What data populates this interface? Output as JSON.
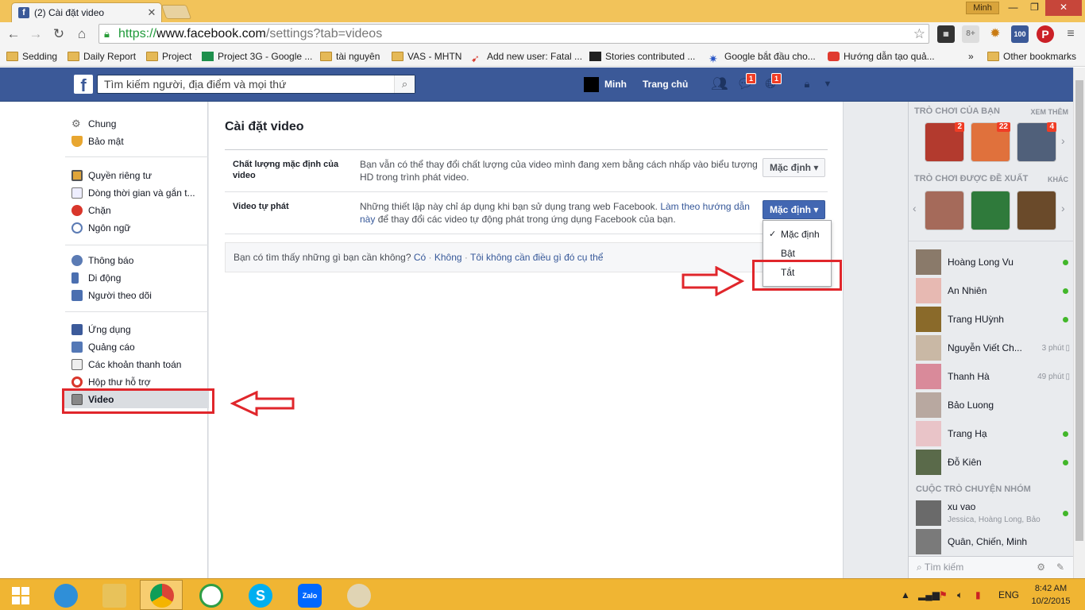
{
  "browser": {
    "tab_title": "(2) Cài đặt video",
    "user_badge": "Minh",
    "url_scheme": "https://",
    "url_host": "www.facebook.com",
    "url_path": "/settings?tab=videos",
    "bookmarks": [
      "Sedding",
      "Daily Report",
      "Project",
      "Project 3G - Google ...",
      "tài nguyên",
      "VAS - MHTN",
      "Add new user: Fatal ...",
      "Stories contributed ...",
      "Google bắt đầu cho...",
      "Hướng dẫn tạo quả..."
    ],
    "bookmarks_more": "»",
    "other_bookmarks": "Other bookmarks",
    "ext_100": "100",
    "ext_gplus": "8+"
  },
  "fb": {
    "logo": "f",
    "search_placeholder": "Tìm kiếm người, địa điểm và mọi thứ",
    "user_name": "Minh",
    "home": "Trang chủ",
    "msg_count": "1",
    "notif_count": "1"
  },
  "left_nav": {
    "group1": [
      "Chung",
      "Bảo mật"
    ],
    "group2": [
      "Quyền riêng tư",
      "Dòng thời gian và gắn t...",
      "Chặn",
      "Ngôn ngữ"
    ],
    "group3": [
      "Thông báo",
      "Di động",
      "Người theo dõi"
    ],
    "group4": [
      "Ứng dụng",
      "Quảng cáo",
      "Các khoản thanh toán",
      "Hộp thư hỗ trợ",
      "Video"
    ]
  },
  "content": {
    "title": "Cài đặt video",
    "row1": {
      "label": "Chất lượng mặc định của video",
      "desc": "Bạn vẫn có thể thay đổi chất lượng của video mình đang xem bằng cách nhấp vào biểu tượng HD trong trình phát video.",
      "button": "Mặc định ▾"
    },
    "row2": {
      "label": "Video tự phát",
      "desc_pre": "Những thiết lập này chỉ áp dụng khi bạn sử dụng trang web Facebook. ",
      "desc_link": "Làm theo hướng dẫn này",
      "desc_post": " để thay đổi các video tự động phát trong ứng dụng Facebook của bạn.",
      "button": "Mặc định ▾"
    },
    "feedback": {
      "question": "Bạn có tìm thấy những gì bạn cần không? ",
      "yes": "Có",
      "sep": " · ",
      "no": "Không",
      "other": "Tôi không cần điều gì đó cụ thể"
    },
    "dropdown": {
      "options": [
        "Mặc định",
        "Bật",
        "Tắt"
      ],
      "selected": "Mặc định",
      "check": "✓"
    }
  },
  "sidebar": {
    "games_title": "TRÒ CHƠI CỦA BẠN",
    "games_more": "XEM THÊM",
    "game_badges": [
      "2",
      "22",
      "4"
    ],
    "suggested_title": "TRÒ CHƠI ĐƯỢC ĐỀ XUẤT",
    "suggested_more": "KHÁC",
    "contacts": [
      {
        "name": "Hoàng Long Vu",
        "status": "online",
        "idle": ""
      },
      {
        "name": "An Nhiên",
        "status": "online",
        "idle": ""
      },
      {
        "name": "Trang HUỳnh",
        "status": "online",
        "idle": ""
      },
      {
        "name": "Nguyễn Viết Ch...",
        "status": "mobile",
        "idle": "3 phút"
      },
      {
        "name": "Thanh Hà",
        "status": "mobile",
        "idle": "49 phút"
      },
      {
        "name": "Bảo Luong",
        "status": "none",
        "idle": ""
      },
      {
        "name": "Trang Hạ",
        "status": "online",
        "idle": ""
      },
      {
        "name": "Đỗ Kiên",
        "status": "online",
        "idle": ""
      }
    ],
    "group_title": "CUỘC TRÒ CHUYỆN NHÓM",
    "groups": [
      {
        "name": "xu vao",
        "members": "Jessica, Hoàng Long, Bảo"
      },
      {
        "name": "Quân, Chiến, Minh",
        "members": ""
      }
    ],
    "search": "Tìm kiếm"
  },
  "taskbar": {
    "lang": "ENG",
    "time": "8:42 AM",
    "date": "10/2/2015",
    "zalo": "Zalo"
  },
  "colors": {
    "fb_blue": "#3b5998",
    "annotation_red": "#e0262b",
    "online_green": "#42b72a"
  }
}
